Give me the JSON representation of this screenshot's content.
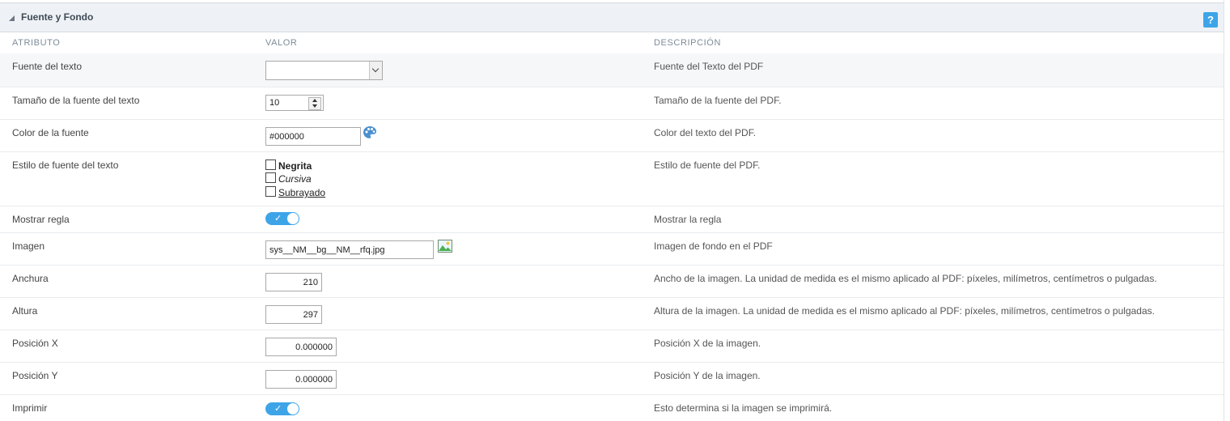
{
  "panel": {
    "title": "Fuente y Fondo",
    "help_label": "?"
  },
  "columns": {
    "attribute": "ATRIBUTO",
    "value": "VALOR",
    "description": "DESCRIPCIÓN"
  },
  "rows": {
    "font": {
      "label": "Fuente del texto",
      "value": "",
      "description": "Fuente del Texto del PDF"
    },
    "font_size": {
      "label": "Tamaño de la fuente del texto",
      "value": "10",
      "description": "Tamaño de la fuente del PDF."
    },
    "font_color": {
      "label": "Color de la fuente",
      "value": "#000000",
      "description": "Color del texto del PDF."
    },
    "font_style": {
      "label": "Estilo de fuente del texto",
      "options": [
        "Negrita",
        "Cursiva",
        "Subrayado"
      ],
      "description": "Estilo de fuente del PDF."
    },
    "show_ruler": {
      "label": "Mostrar regla",
      "enabled": true,
      "description": "Mostrar la regla"
    },
    "image": {
      "label": "Imagen",
      "value": "sys__NM__bg__NM__rfq.jpg",
      "description": "Imagen de fondo en el PDF"
    },
    "width": {
      "label": "Anchura",
      "value": "210",
      "description": "Ancho de la imagen. La unidad de medida es el mismo aplicado al PDF: píxeles, milímetros, centímetros o pulgadas."
    },
    "height": {
      "label": "Altura",
      "value": "297",
      "description": "Altura de la imagen. La unidad de medida es el mismo aplicado al PDF: píxeles, milímetros, centímetros o pulgadas."
    },
    "pos_x": {
      "label": "Posición X",
      "value": "0.000000",
      "description": "Posición X de la imagen."
    },
    "pos_y": {
      "label": "Posición Y",
      "value": "0.000000",
      "description": "Posición Y de la imagen."
    },
    "print": {
      "label": "Imprimir",
      "enabled": true,
      "description": "Esto determina si la imagen se imprimirá."
    }
  },
  "colors": {
    "accent": "#3ea4e8",
    "header_bg": "#eef1f5",
    "palette_icon": "#4a8fcf",
    "image_icon": "#4caf50"
  },
  "icons": {
    "palette": "palette-icon",
    "image": "image-icon",
    "collapse": "collapse-triangle-icon",
    "help": "help-icon"
  }
}
